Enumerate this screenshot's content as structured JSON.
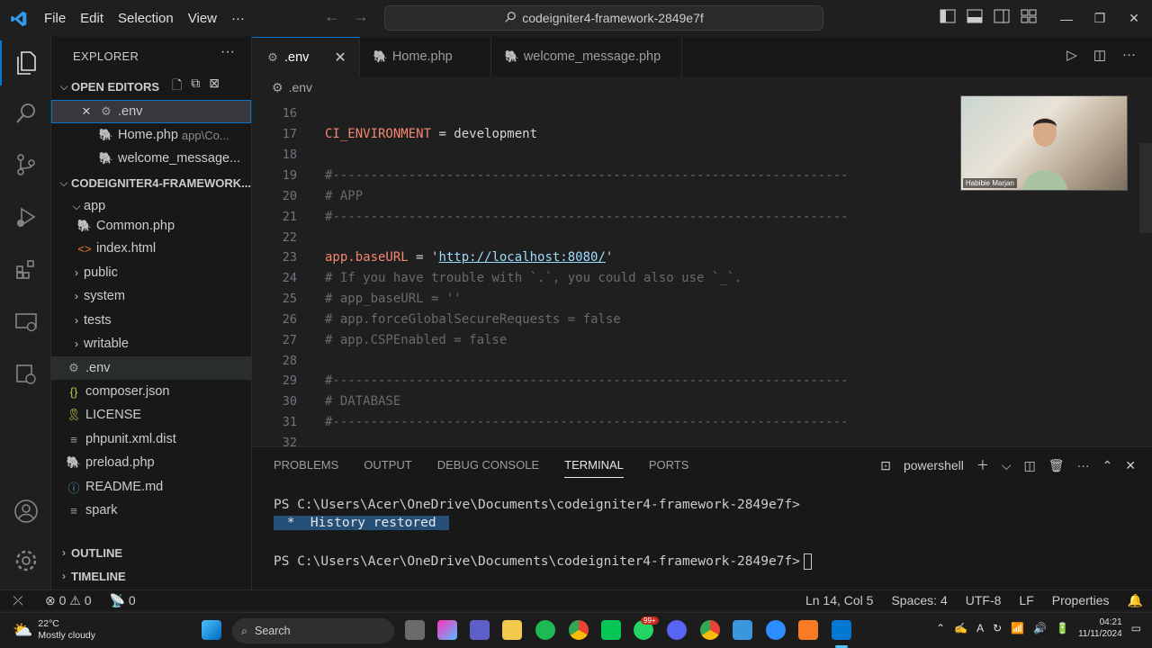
{
  "titlebar": {
    "menu": [
      "File",
      "Edit",
      "Selection",
      "View"
    ],
    "more": "···",
    "command_center": "codeigniter4-framework-2849e7f",
    "accent_color": "#0078d4"
  },
  "sidebar": {
    "title": "EXPLORER",
    "more": "···",
    "open_editors_label": "OPEN EDITORS",
    "open_editors": [
      {
        "name": ".env",
        "hint": ""
      },
      {
        "name": "Home.php",
        "hint": "app\\Co..."
      },
      {
        "name": "welcome_message...",
        "hint": ""
      }
    ],
    "project_label": "CODEIGNITER4-FRAMEWORK...",
    "tree": {
      "app": "app",
      "common": "Common.php",
      "index": "index.html",
      "public": "public",
      "system": "system",
      "tests": "tests",
      "writable": "writable",
      "env": ".env",
      "composer": "composer.json",
      "license": "LICENSE",
      "phpunit": "phpunit.xml.dist",
      "preload": "preload.php",
      "readme": "README.md",
      "spark": "spark"
    },
    "outline_label": "OUTLINE",
    "timeline_label": "TIMELINE"
  },
  "tabs": [
    {
      "label": ".env",
      "active": true
    },
    {
      "label": "Home.php",
      "active": false
    },
    {
      "label": "welcome_message.php",
      "active": false
    }
  ],
  "breadcrumb": ".env",
  "editor": {
    "lines": [
      {
        "n": "16",
        "text": ""
      },
      {
        "n": "17",
        "key": "CI_ENVIRONMENT",
        "rest": " = development"
      },
      {
        "n": "18",
        "text": ""
      },
      {
        "n": "19",
        "comment": "#--------------------------------------------------------------------"
      },
      {
        "n": "20",
        "comment": "# APP"
      },
      {
        "n": "21",
        "comment": "#--------------------------------------------------------------------"
      },
      {
        "n": "22",
        "text": ""
      },
      {
        "n": "23",
        "key": "app.baseURL",
        "rest": " = '",
        "url": "http://localhost:8080/",
        "tail": "'"
      },
      {
        "n": "24",
        "comment": "# If you have trouble with `.`, you could also use `_`."
      },
      {
        "n": "25",
        "comment": "# app_baseURL = ''"
      },
      {
        "n": "26",
        "comment": "# app.forceGlobalSecureRequests = false"
      },
      {
        "n": "27",
        "comment": "# app.CSPEnabled = false"
      },
      {
        "n": "28",
        "text": ""
      },
      {
        "n": "29",
        "comment": "#--------------------------------------------------------------------"
      },
      {
        "n": "30",
        "comment": "# DATABASE"
      },
      {
        "n": "31",
        "comment": "#--------------------------------------------------------------------"
      },
      {
        "n": "32",
        "text": ""
      }
    ]
  },
  "webcam": {
    "name": "Habibie Marjan"
  },
  "panel": {
    "tabs": [
      "PROBLEMS",
      "OUTPUT",
      "DEBUG CONSOLE",
      "TERMINAL",
      "PORTS"
    ],
    "active_tab": "TERMINAL",
    "shell": "powershell",
    "terminal": {
      "prompt1": "PS C:\\Users\\Acer\\OneDrive\\Documents\\codeigniter4-framework-2849e7f>",
      "restored": " *  History restored ",
      "prompt2": "PS C:\\Users\\Acer\\OneDrive\\Documents\\codeigniter4-framework-2849e7f>"
    }
  },
  "statusbar": {
    "errors": "0",
    "warnings": "0",
    "ports": "0",
    "position": "Ln 14, Col 5",
    "spaces": "Spaces: 4",
    "encoding": "UTF-8",
    "eol": "LF",
    "language": "Properties"
  },
  "taskbar": {
    "temperature": "22°C",
    "weather": "Mostly cloudy",
    "search": "Search",
    "time": "04:21",
    "date": "11/11/2024",
    "badge": "99+"
  }
}
